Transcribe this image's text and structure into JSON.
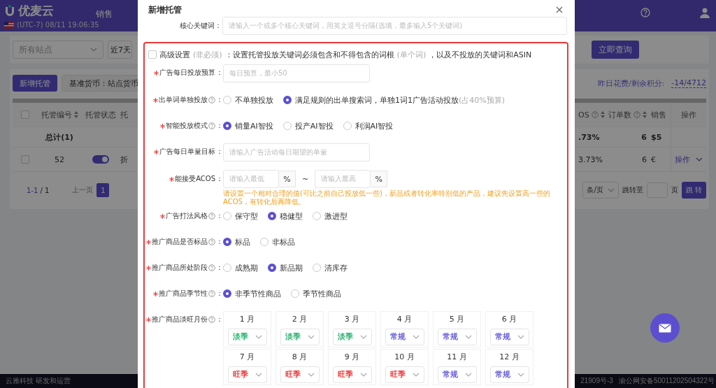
{
  "header": {
    "logo": "优麦云",
    "menu_item": "销售",
    "clock": "(UTC-7) 08/11 19:06:35"
  },
  "filters": {
    "site": "所有站点",
    "range": "近7天",
    "query_button": "立即查询"
  },
  "toolbar": {
    "add_button": "新增托管",
    "currency_button": "基准货币：站点货币",
    "credits_label": "昨日花费/剩余积分:",
    "credits_value": "-14/4712"
  },
  "table": {
    "all_checked": false,
    "columns_left": [
      {
        "label": "托管编号",
        "sortable": true,
        "help": false
      },
      {
        "label": "托管状态",
        "sortable": false,
        "help": false
      },
      {
        "label": "托",
        "sortable": false,
        "help": false
      }
    ],
    "columns_right": [
      {
        "label": "OS",
        "sortable": true,
        "help": true
      },
      {
        "label": "订单数",
        "sortable": true,
        "help": true
      },
      {
        "label": "销售",
        "sortable": false,
        "help": false
      },
      {
        "label": "操作",
        "sortable": false,
        "help": false
      }
    ],
    "rows": [
      {
        "kind": "total",
        "label": "总计(1)",
        "acos": ".73%",
        "orders": "6",
        "sales": "$5"
      },
      {
        "kind": "item",
        "checked": false,
        "id": "52",
        "on": true,
        "type": "折",
        "acos": "3.73%",
        "orders": "6",
        "sales": "€",
        "action": "操作"
      }
    ]
  },
  "pagination": {
    "range": "1-1",
    "total": "/ 1",
    "prev": "上一页",
    "pages": [
      {
        "label": "1",
        "selected": true
      }
    ],
    "page_size": "条/页",
    "jump_label": "跳转至",
    "page_unit": "页",
    "jump_button": "跳 转"
  },
  "footer": {
    "company": "云雅科技 研发和运营",
    "icp": "21909号-3",
    "police": "渝公网安备50011202504322号"
  },
  "modal": {
    "title": "新增托管",
    "keyword": {
      "label": "核心关键词：",
      "placeholder": "请输入一个或多个核心关键词，用英文逗号分隔(选填，最多输入5个关键词)"
    },
    "advanced": {
      "checked": false,
      "label": "高级设置",
      "note": "(非必须)",
      "description": "：设置托管投放关键词必须包含和不得包含的词根",
      "description_note": "(单个词)",
      "description_tail": "，以及不投放的关键词和ASIN"
    },
    "fields": [
      {
        "kind": "input",
        "label": "广告每日投放预算",
        "required": true,
        "help": false,
        "colon": "：",
        "placeholder": "每日预算，最小50"
      },
      {
        "kind": "radio",
        "label": "出单词单独投放",
        "required": true,
        "help": true,
        "colon": "：",
        "options": [
          {
            "label": "不单独投放",
            "selected": false
          },
          {
            "label": "满足规则的出单搜索词，单独1词1广告活动投放",
            "note": "(占40%预算)",
            "selected": true
          }
        ]
      },
      {
        "kind": "radio",
        "label": "智能投放模式",
        "required": true,
        "help": true,
        "colon": "：",
        "options": [
          {
            "label": "销量AI智投",
            "selected": true
          },
          {
            "label": "投产AI智投",
            "selected": false
          },
          {
            "label": "利润AI智投",
            "selected": false
          }
        ]
      },
      {
        "kind": "input",
        "label": "广告每日单量目标",
        "required": true,
        "help": false,
        "colon": "：",
        "placeholder": "请输入广告活动每日期望的单量"
      },
      {
        "kind": "range",
        "label": "能接受ACOS",
        "required": true,
        "help": false,
        "colon": "：",
        "min_placeholder": "请输入最低",
        "min_unit": "%",
        "separator": "~",
        "max_placeholder": "请输入最高",
        "max_unit": "%",
        "hint": "请设置一个相对合理的值(可比之前自己投放低一些)，新品或者转化率特别低的产品，建议先设置高一些的ACOS，有转化后再降低。"
      },
      {
        "kind": "radio",
        "label": "广告打法风格",
        "required": true,
        "help": true,
        "colon": "：",
        "options": [
          {
            "label": "保守型",
            "selected": false
          },
          {
            "label": "稳健型",
            "selected": true
          },
          {
            "label": "激进型",
            "selected": false
          }
        ]
      },
      {
        "kind": "radio",
        "label": "推广商品是否标品",
        "required": true,
        "help": true,
        "colon": "：",
        "options": [
          {
            "label": "标品",
            "selected": true
          },
          {
            "label": "非标品",
            "selected": false
          }
        ]
      },
      {
        "kind": "radio",
        "label": "推广商品所处阶段",
        "required": true,
        "help": true,
        "colon": "：",
        "options": [
          {
            "label": "成熟期",
            "selected": false
          },
          {
            "label": "新品期",
            "selected": true
          },
          {
            "label": "清库存",
            "selected": false
          }
        ]
      },
      {
        "kind": "radio",
        "label": "推广商品季节性",
        "required": true,
        "help": true,
        "colon": "：",
        "options": [
          {
            "label": "非季节性商品",
            "selected": true
          },
          {
            "label": "季节性商品",
            "selected": false
          }
        ]
      },
      {
        "kind": "months",
        "label": "推广商品淡旺月份",
        "required": true,
        "help": true,
        "colon": "：",
        "months": [
          {
            "month": "1 月",
            "season": "淡季",
            "color": "#2bb673"
          },
          {
            "month": "2 月",
            "season": "淡季",
            "color": "#2bb673"
          },
          {
            "month": "3 月",
            "season": "淡季",
            "color": "#2bb673"
          },
          {
            "month": "4 月",
            "season": "常规",
            "color": "#6b63d8"
          },
          {
            "month": "5 月",
            "season": "常规",
            "color": "#6b63d8"
          },
          {
            "month": "6 月",
            "season": "常规",
            "color": "#6b63d8"
          },
          {
            "month": "7 月",
            "season": "旺季",
            "color": "#f03c3c"
          },
          {
            "month": "8 月",
            "season": "旺季",
            "color": "#f03c3c"
          },
          {
            "month": "9 月",
            "season": "旺季",
            "color": "#f03c3c"
          },
          {
            "month": "10 月",
            "season": "旺季",
            "color": "#f03c3c"
          },
          {
            "month": "11 月",
            "season": "常规",
            "color": "#6b63d8"
          },
          {
            "month": "12 月",
            "season": "常规",
            "color": "#6b63d8"
          }
        ]
      }
    ]
  }
}
